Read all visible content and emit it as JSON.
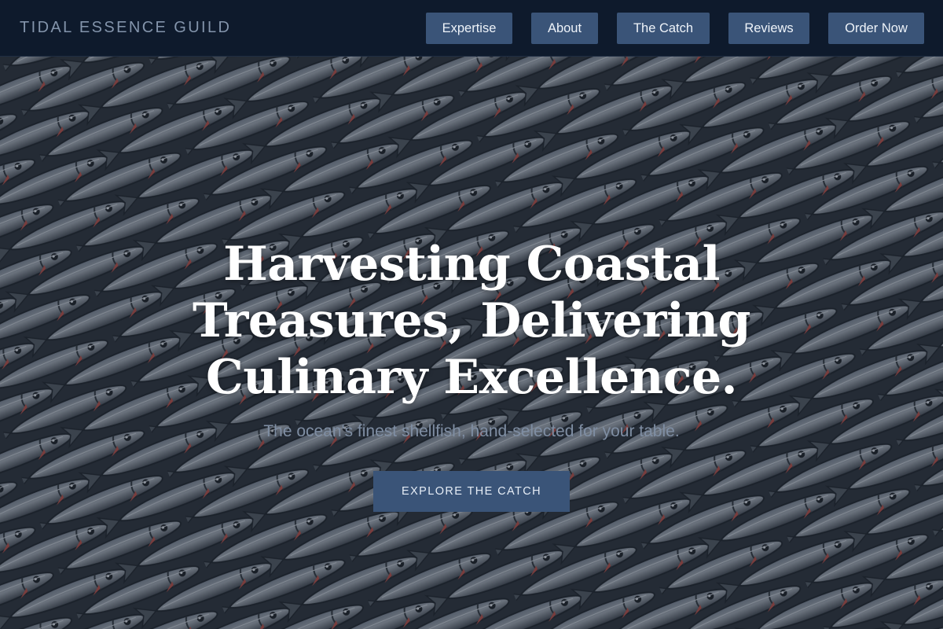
{
  "brand": {
    "name": "TIDAL ESSENCE GUILD"
  },
  "nav": {
    "items": [
      {
        "label": "Expertise"
      },
      {
        "label": "About"
      },
      {
        "label": "The Catch"
      },
      {
        "label": "Reviews"
      },
      {
        "label": "Order Now"
      }
    ]
  },
  "hero": {
    "title_lines": [
      "Harvesting Coastal",
      "Treasures, Delivering",
      "Culinary Excellence."
    ],
    "subtitle": "The ocean's finest shellfish, hand-selected for your table.",
    "cta_label": "EXPLORE THE CATCH",
    "background": "fish-pile-photo"
  },
  "colors": {
    "navbar_bg": "#0e1a2c",
    "button_bg": "#3a5478",
    "brand_text": "#8394ab",
    "hero_title": "#ffffff",
    "hero_subtitle": "#7f8ea3"
  }
}
